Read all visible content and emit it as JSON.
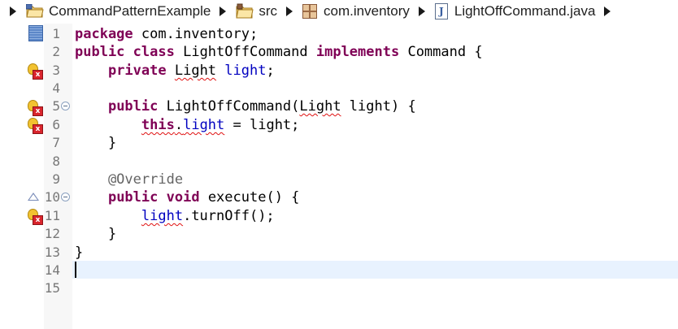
{
  "breadcrumb": {
    "items": [
      {
        "label": "CommandPatternExample",
        "icon": "project-folder-icon"
      },
      {
        "label": "src",
        "icon": "source-folder-icon"
      },
      {
        "label": "com.inventory",
        "icon": "package-icon"
      },
      {
        "label": "LightOffCommand.java",
        "icon": "java-file-icon"
      }
    ]
  },
  "editor": {
    "line_numbers": [
      "1",
      "2",
      "3",
      "4",
      "5",
      "6",
      "7",
      "8",
      "9",
      "10",
      "11",
      "12",
      "13",
      "14",
      "15"
    ],
    "lines": {
      "l1_kw": "package",
      "l1_rest": " com.inventory;",
      "l2_kw1": "public",
      "l2_kw2": "class",
      "l2_mid": " LightOffCommand ",
      "l2_kw3": "implements",
      "l2_rest": " Command {",
      "l3_indent": "    ",
      "l3_kw": "private",
      "l3_sp": " ",
      "l3_type": "Light",
      "l3_sp2": " ",
      "l3_field": "light",
      "l3_end": ";",
      "l5_indent": "    ",
      "l5_kw": "public",
      "l5_mid": " LightOffCommand(",
      "l5_type": "Light",
      "l5_rest": " light) {",
      "l6_indent": "        ",
      "l6_kw": "this",
      "l6_dot": ".",
      "l6_field": "light",
      "l6_rest": " = light;",
      "l7": "    }",
      "l9": "    @Override",
      "l10_indent": "    ",
      "l10_kw1": "public",
      "l10_sp": " ",
      "l10_kw2": "void",
      "l10_rest": " execute() {",
      "l11_indent": "        ",
      "l11_field": "light",
      "l11_rest": ".turnOff();",
      "l12": "    }",
      "l13": "}"
    }
  },
  "colors": {
    "keyword": "#7f0055",
    "field": "#0000c0",
    "annotation": "#646464",
    "current_line": "#e8f2fe",
    "error_underline": "#e01010"
  }
}
